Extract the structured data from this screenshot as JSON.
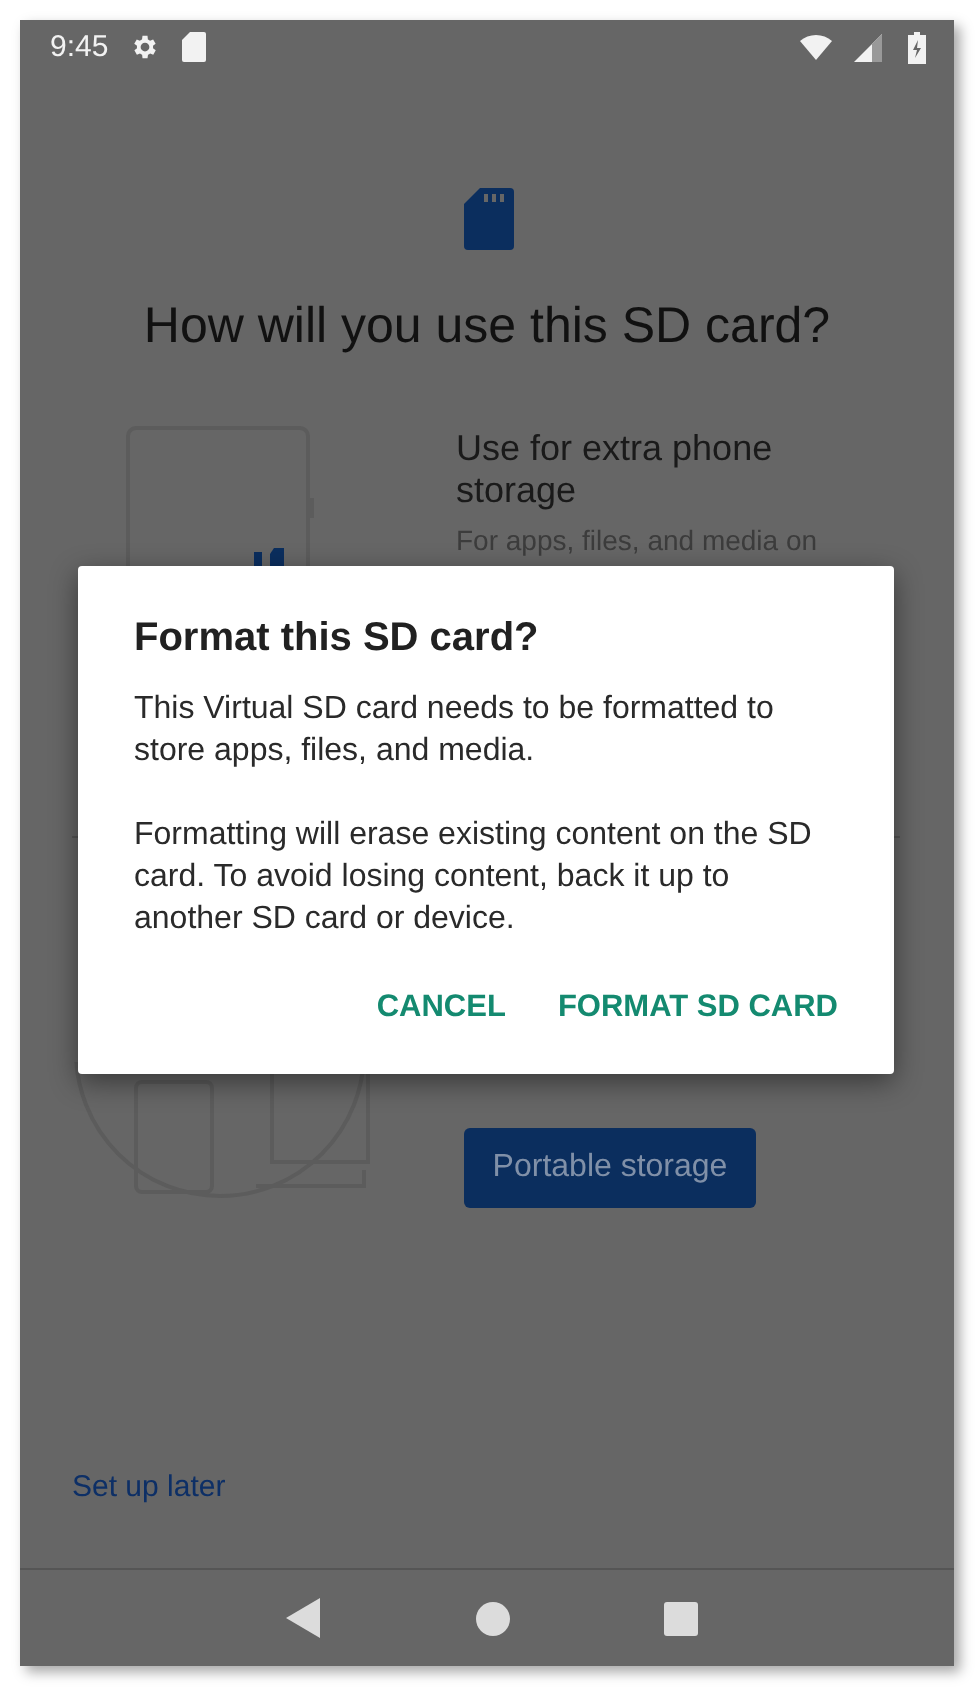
{
  "status_bar": {
    "time": "9:45"
  },
  "header": {
    "title": "How will you use this SD card?"
  },
  "internal_option": {
    "title": "Use for extra phone storage",
    "description": "For apps, files, and media on"
  },
  "portable_option": {
    "button": "Portable storage"
  },
  "footer": {
    "link": "Set up later"
  },
  "dialog": {
    "title": "Format this SD card?",
    "paragraphs": [
      "This Virtual SD card needs to be formatted to store apps, files, and media.",
      "Formatting will erase existing content on the SD card. To avoid losing content, back it up to another SD card or device."
    ],
    "buttons": [
      {
        "label": "CANCEL"
      },
      {
        "label": "FORMAT SD CARD"
      }
    ]
  }
}
